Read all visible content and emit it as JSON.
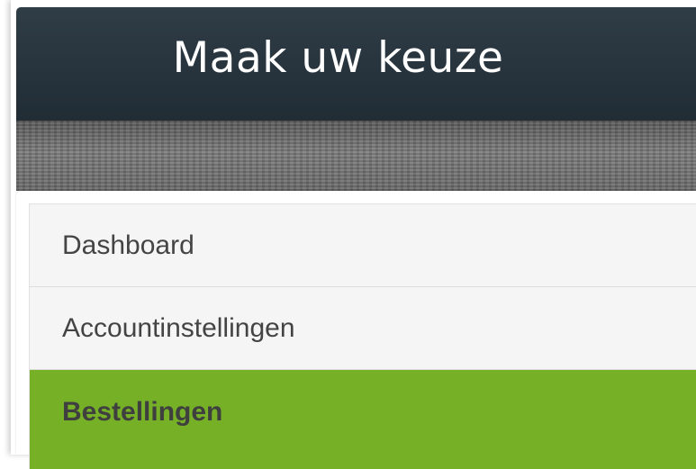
{
  "panel": {
    "title": "Maak uw keuze"
  },
  "menu": {
    "items": [
      {
        "label": "Dashboard",
        "active": false
      },
      {
        "label": "Accountinstellingen",
        "active": false
      },
      {
        "label": "Bestellingen",
        "active": true
      }
    ]
  },
  "colors": {
    "header_bg": "#26323b",
    "active_bg": "#75b027",
    "item_bg": "#f5f5f5",
    "item_text": "#444444"
  }
}
